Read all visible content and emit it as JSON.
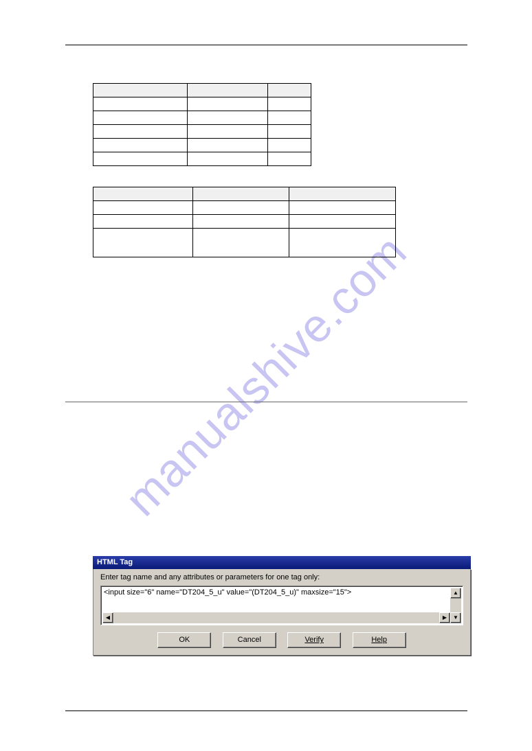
{
  "watermark": "manualshive.com",
  "table1": {
    "headers": [
      "",
      "",
      ""
    ],
    "rows": [
      [
        "",
        "",
        ""
      ],
      [
        "",
        "",
        ""
      ],
      [
        "",
        "",
        ""
      ],
      [
        "",
        "",
        ""
      ],
      [
        "",
        "",
        ""
      ]
    ]
  },
  "table2": {
    "headers": [
      "",
      "",
      ""
    ],
    "rows": [
      [
        "",
        "",
        ""
      ],
      [
        "",
        "",
        ""
      ],
      [
        "",
        "",
        ""
      ]
    ]
  },
  "dialog": {
    "title": "HTML Tag",
    "prompt": "Enter tag name and any attributes or parameters for one tag only:",
    "textarea_value": "<input size=\"6\" name=\"DT204_5_u\" value=\"(DT204_5_u)\" maxsize=\"15\">",
    "buttons": {
      "ok": "OK",
      "cancel": "Cancel",
      "verify": "Verify",
      "help": "Help"
    },
    "scroll_glyphs": {
      "up": "▲",
      "down": "▼",
      "left": "◀",
      "right": "▶"
    }
  }
}
